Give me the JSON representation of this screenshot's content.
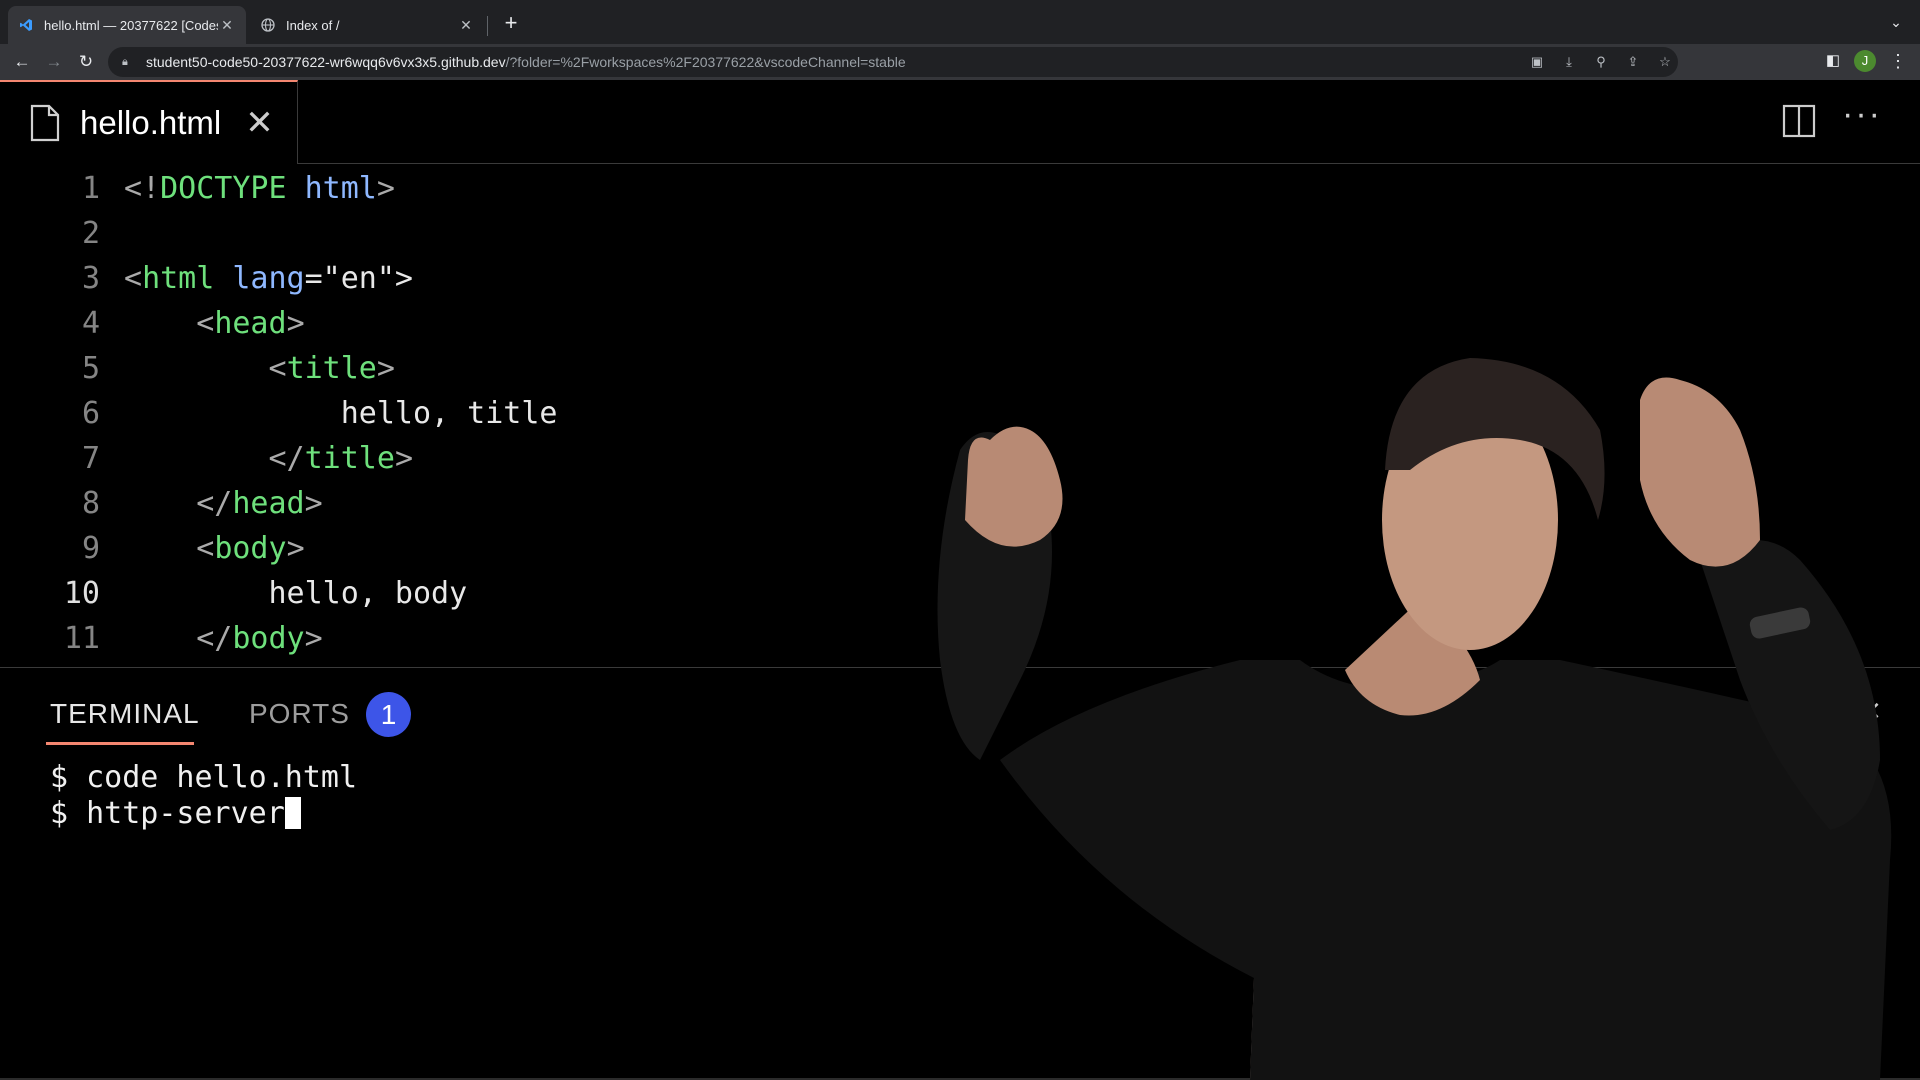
{
  "browser": {
    "tabs": [
      {
        "title": "hello.html — 20377622 [Codes",
        "icon": "vscode-icon"
      },
      {
        "title": "Index of /",
        "icon": "globe-icon"
      }
    ],
    "url_host": "student50-code50-20377622-wr6wqq6v6vx3x5.github.dev",
    "url_path": "/?folder=%2Fworkspaces%2F20377622&vscodeChannel=stable",
    "avatar_letter": "J"
  },
  "editor": {
    "tab_label": "hello.html",
    "line_numbers": [
      "1",
      "2",
      "3",
      "4",
      "5",
      "6",
      "7",
      "8",
      "9",
      "10",
      "11"
    ],
    "active_line": "10",
    "lines": [
      {
        "t1": "<!",
        "t2": "DOCTYPE",
        "t3": " ",
        "t4": "html",
        "t5": ">"
      },
      {
        "t1": "",
        "t2": "",
        "t3": "",
        "t4": "",
        "t5": ""
      },
      {
        "t1": "<",
        "t2": "html",
        "t3": " ",
        "t4": "lang",
        "t5": "=\"en\">"
      },
      {
        "t1": "    <",
        "t2": "head",
        "t3": "",
        "t4": "",
        "t5": ">"
      },
      {
        "t1": "        <",
        "t2": "title",
        "t3": "",
        "t4": "",
        "t5": ">"
      },
      {
        "t1": "            hello, title",
        "t2": "",
        "t3": "",
        "t4": "",
        "t5": ""
      },
      {
        "t1": "        </",
        "t2": "title",
        "t3": "",
        "t4": "",
        "t5": ">"
      },
      {
        "t1": "    </",
        "t2": "head",
        "t3": "",
        "t4": "",
        "t5": ">"
      },
      {
        "t1": "    <",
        "t2": "body",
        "t3": "",
        "t4": "",
        "t5": ">"
      },
      {
        "t1": "        hello, body",
        "t2": "",
        "t3": "",
        "t4": "",
        "t5": ""
      },
      {
        "t1": "    </",
        "t2": "body",
        "t3": "",
        "t4": "",
        "t5": ">"
      }
    ]
  },
  "panel": {
    "terminal_label": "TERMINAL",
    "ports_label": "PORTS",
    "ports_count": "1",
    "terminal_lines": [
      "$ code hello.html",
      "$ http-server"
    ]
  },
  "colors": {
    "accent": "#f48771",
    "badge": "#3d55e8",
    "tag": "#6ee07c",
    "attr": "#8fb8ff"
  }
}
